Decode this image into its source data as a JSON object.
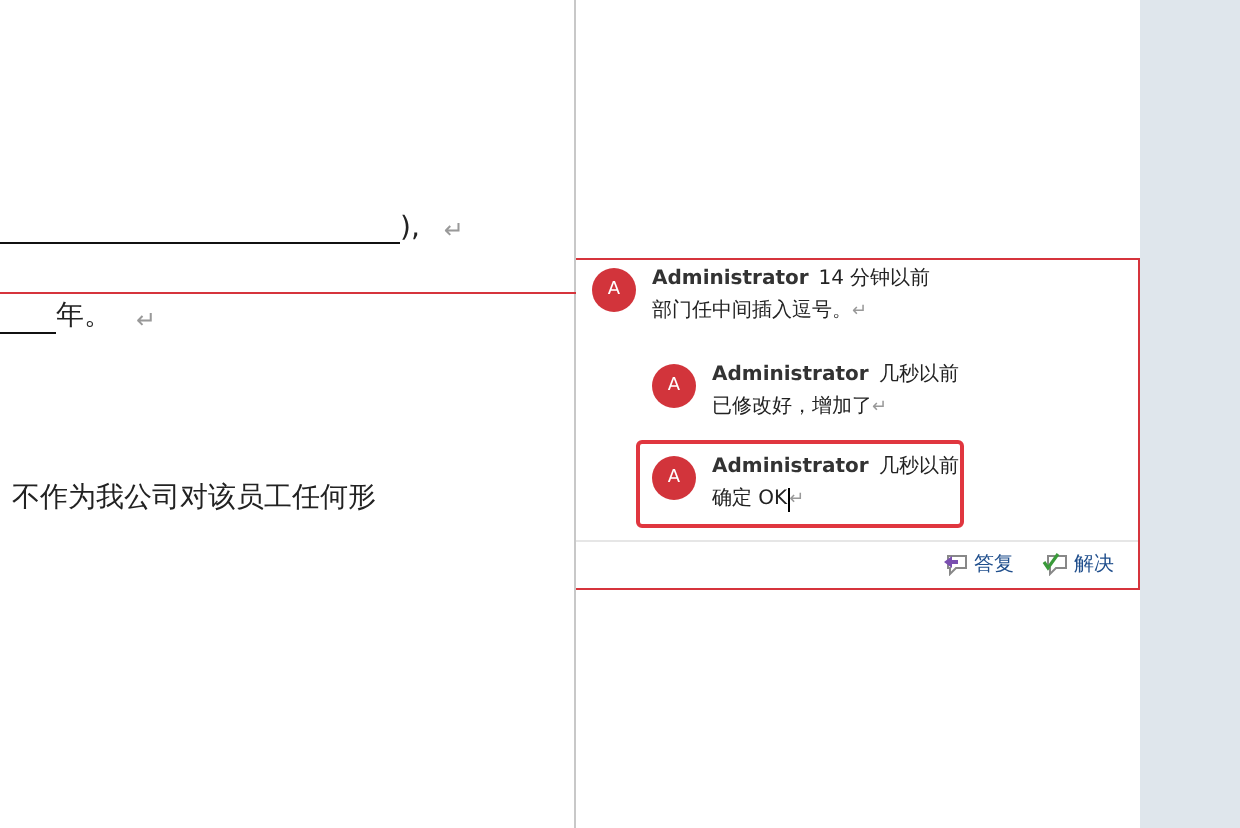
{
  "document": {
    "lines": [
      {
        "kind": "long_blank",
        "text": "),",
        "mark": "↵"
      },
      {
        "kind": "short_blank",
        "text": "年。",
        "mark": "↵"
      },
      {
        "kind": "plain",
        "text": "不作为我公司对该员工任何形"
      }
    ]
  },
  "comment_thread": {
    "comments": [
      {
        "avatar": "A",
        "author": "Administrator",
        "time": "14 分钟以前",
        "text": "部门任中间插入逗号。",
        "mark": "↵",
        "selected": false,
        "children": [
          {
            "avatar": "A",
            "author": "Administrator",
            "time": "几秒以前",
            "text": "已修改好，增加了",
            "mark": "↵",
            "selected": false
          },
          {
            "avatar": "A",
            "author": "Administrator",
            "time": "几秒以前",
            "text": "确定 OK",
            "mark": "↵",
            "selected": true
          }
        ]
      }
    ],
    "actions": [
      {
        "kind": "reply",
        "label": "答复"
      },
      {
        "kind": "resolve",
        "label": "解决"
      }
    ]
  }
}
